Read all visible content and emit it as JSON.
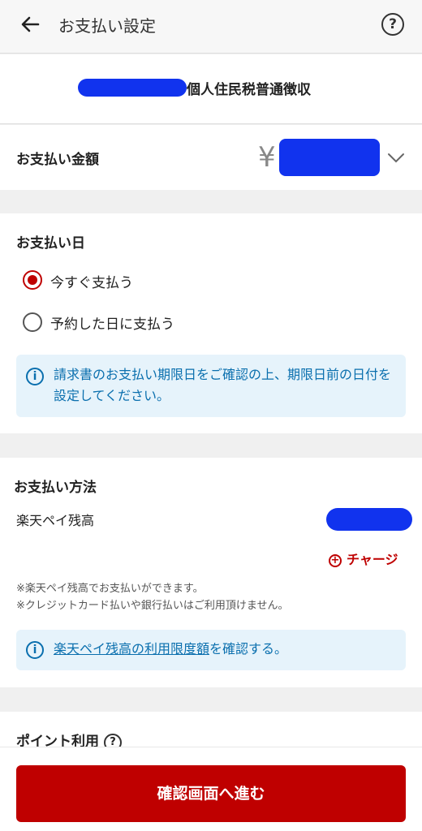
{
  "header": {
    "back_icon": "arrow-left-icon",
    "title": "お支払い設定",
    "help_icon": "question-circle-icon"
  },
  "payee": {
    "label": "個人住民税普通徴収"
  },
  "amount": {
    "label": "お支払い金額",
    "currency": "¥"
  },
  "pay_date": {
    "title": "お支払い日",
    "options": [
      {
        "label": "今すぐ支払う",
        "selected": true
      },
      {
        "label": "予約した日に支払う",
        "selected": false
      }
    ],
    "info": "請求書のお支払い期限日をご確認の上、期限日前の日付を設定してください。"
  },
  "pay_method": {
    "title": "お支払い方法",
    "method": "楽天ペイ残高",
    "charge_label": "チャージ",
    "notes": [
      "※楽天ペイ残高でお支払いができます。",
      "※クレジットカード払いや銀行払いはご利用頂けません。"
    ],
    "info_link": "楽天ペイ残高の利用限度額",
    "info_suffix": "を確認する。"
  },
  "points": {
    "title": "ポイント利用"
  },
  "footer": {
    "cta": "確認画面へ進む"
  },
  "colors": {
    "accent": "#bf0000",
    "info_bg": "#e6f3fb",
    "info_text": "#0a6fae"
  }
}
